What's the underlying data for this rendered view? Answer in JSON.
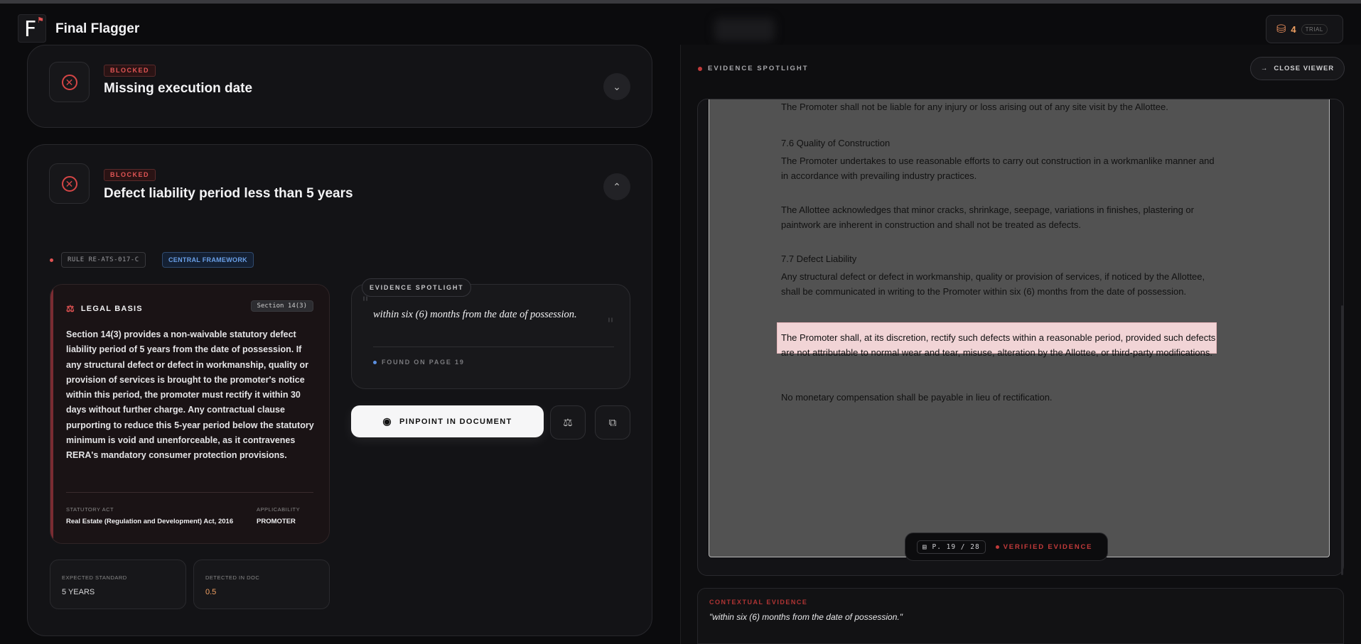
{
  "app": {
    "title": "Final Flagger",
    "logo_letter": "F"
  },
  "credits": {
    "count": "4",
    "plan": "TRIAL"
  },
  "issues": [
    {
      "status": "BLOCKED",
      "title": "Missing execution date"
    },
    {
      "status": "BLOCKED",
      "title": "Defect liability period less than 5 years"
    }
  ],
  "rule": {
    "id": "RULE RE-ATS-017-C",
    "framework": "CENTRAL FRAMEWORK"
  },
  "legal": {
    "heading": "LEGAL BASIS",
    "section": "Section 14(3)",
    "body": "Section 14(3) provides a non-waivable statutory defect liability period of 5 years from the date of possession. If any structural defect or defect in workmanship, quality or provision of services is brought to the promoter's notice within this period, the promoter must rectify it within 30 days without further charge. Any contractual clause purporting to reduce this 5-year period below the statutory minimum is void and unenforceable, as it contravenes RERA's mandatory consumer protection provisions.",
    "statutory_act_label": "STATUTORY ACT",
    "statutory_act": "Real Estate (Regulation and Development) Act, 2016",
    "applicability_label": "APPLICABILITY",
    "applicability": "PROMOTER"
  },
  "comparison": {
    "expected_label": "EXPECTED STANDARD",
    "expected": "5 YEARS",
    "detected_label": "DETECTED IN DOC",
    "detected": "0.5"
  },
  "spotlight": {
    "label": "EVIDENCE SPOTLIGHT",
    "quote": "within six (6) months from the date of possession.",
    "found": "FOUND ON PAGE 19"
  },
  "actions": {
    "pinpoint": "PINPOINT IN DOCUMENT"
  },
  "viewer": {
    "heading": "EVIDENCE SPOTLIGHT",
    "close": "CLOSE VIEWER",
    "paragraphs": [
      "The Promoter shall not be liable for any injury or loss arising out of any site visit by the Allottee.",
      "7.6 Quality of Construction",
      "The Promoter undertakes to use reasonable efforts to carry out construction in a workmanlike manner and in accordance with prevailing industry practices.",
      "The Allottee acknowledges that minor cracks, shrinkage, seepage, variations in finishes, plastering or paintwork are inherent in construction and shall not be treated as defects.",
      "7.7 Defect Liability",
      "Any structural defect or defect in workmanship, quality or provision of services, if noticed by the Allottee, shall be communicated in writing to the Promoter within six (6) months from the date of possession.",
      "The Promoter shall, at its discretion, rectify such defects within a reasonable period, provided such defects are not attributable to normal wear and tear, misuse, alteration by the Allottee, or third-party modifications.",
      "No monetary compensation shall be payable in lieu of rectification."
    ],
    "page": "P. 19  /  28",
    "verified": "VERIFIED EVIDENCE",
    "context_label": "CONTEXTUAL EVIDENCE",
    "context_quote": "\"within six (6) months from the date of possession.\""
  },
  "colors": {
    "accent_red": "#e05252",
    "accent_blue": "#6aa0e8",
    "accent_orange": "#f0a062"
  }
}
